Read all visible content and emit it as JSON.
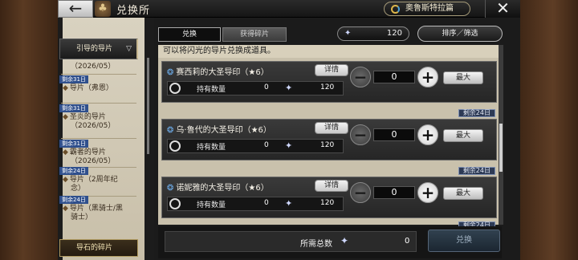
{
  "header": {
    "back_icon": "←",
    "crest_icon": "♣",
    "title": "兑换所",
    "story_button": "奥鲁斯特拉篇",
    "close_icon": "✕"
  },
  "tabs": {
    "exchange": "兑换",
    "shards": "获得碎片"
  },
  "currency": {
    "icon": "✦",
    "amount": "120"
  },
  "sort_label": "排序／筛选",
  "instruction": "可以将闪光的导片兑换成道具。",
  "sidebar": {
    "header": "引导的导片",
    "chevron": "▽",
    "items": [
      {
        "badge": "",
        "line1": "（2026/05）",
        "line2": ""
      },
      {
        "badge": "剩余31日",
        "line1": "导片（弗恩）",
        "line2": ""
      },
      {
        "badge": "剩余31日",
        "line1": "圣炎的导片",
        "line2": "（2026/05）"
      },
      {
        "badge": "剩余31日",
        "line1": "霸者的导片",
        "line2": "（2026/05）"
      },
      {
        "badge": "剩余24日",
        "line1": "导片（2周年纪",
        "line2": "念）"
      },
      {
        "badge": "剩余24日",
        "line1": "导片（黑骑士/黑",
        "line2": "骑士）"
      }
    ],
    "selected": "导石的碎片"
  },
  "cards": [
    {
      "name": "赛西莉的大圣导印（★6）",
      "detail": "详情",
      "stock_label": "持有数量",
      "stock": "0",
      "cost": "120",
      "qty": "0",
      "max": "最大",
      "remaining": ""
    },
    {
      "name": "乌·鲁代的大圣导印（★6）",
      "detail": "详情",
      "stock_label": "持有数量",
      "stock": "0",
      "cost": "120",
      "qty": "0",
      "max": "最大",
      "remaining": "剩余24日"
    },
    {
      "name": "诺妮雅的大圣导印（★6）",
      "detail": "详情",
      "stock_label": "持有数量",
      "stock": "0",
      "cost": "120",
      "qty": "0",
      "max": "最大",
      "remaining": "剩余24日"
    }
  ],
  "footer": {
    "total_label": "所需总数",
    "total_value": "0",
    "exchange_button": "兑换",
    "last_remaining": "剩余24日"
  }
}
